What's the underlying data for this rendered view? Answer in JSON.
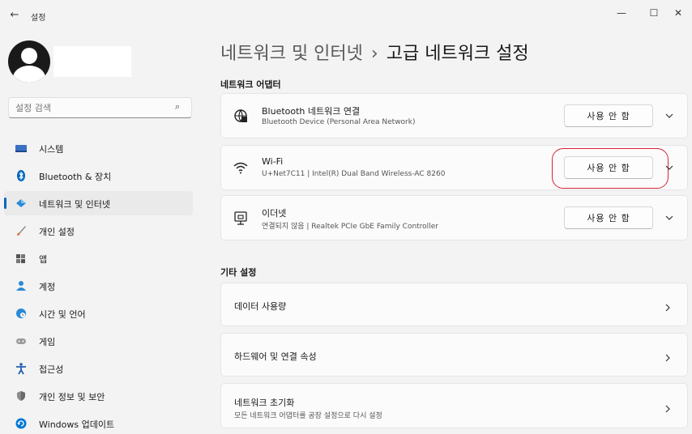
{
  "window": {
    "title": "설정",
    "back_glyph": "←",
    "minimize_glyph": "—",
    "maximize_glyph": "☐",
    "close_glyph": "✕"
  },
  "sidebar": {
    "search": {
      "placeholder": "설정 검색",
      "icon": "⌕"
    },
    "items": [
      {
        "label": "시스템",
        "icon": "monitor-icon",
        "color": "#3a6fc4"
      },
      {
        "label": "Bluetooth & 장치",
        "icon": "bluetooth-icon",
        "color": "#0067c0"
      },
      {
        "label": "네트워크 및 인터넷",
        "icon": "network-diamond-icon",
        "color": "#2a8ad8",
        "selected": true
      },
      {
        "label": "개인 설정",
        "icon": "brush-icon",
        "color": "#d6743a"
      },
      {
        "label": "앱",
        "icon": "apps-icon",
        "color": "#555555"
      },
      {
        "label": "계정",
        "icon": "person-icon",
        "color": "#2a8ad8"
      },
      {
        "label": "시간 및 언어",
        "icon": "globe-clock-icon",
        "color": "#2a8ad8"
      },
      {
        "label": "게임",
        "icon": "gamepad-icon",
        "color": "#888888"
      },
      {
        "label": "접근성",
        "icon": "accessibility-icon",
        "color": "#1f5fb0"
      },
      {
        "label": "개인 정보 및 보안",
        "icon": "shield-icon",
        "color": "#7a7a7a"
      },
      {
        "label": "Windows 업데이트",
        "icon": "update-icon",
        "color": "#0078d4"
      }
    ]
  },
  "main": {
    "breadcrumb": {
      "parent": "네트워크 및 인터넷",
      "separator": "›",
      "current": "고급 네트워크 설정"
    },
    "adapters_section": {
      "title": "네트워크 어댑터",
      "adapters": [
        {
          "name": "Bluetooth 네트워크 연결",
          "description": "Bluetooth Device (Personal Area Network)",
          "button": "사용 안 함",
          "icon": "bluetooth-network-icon"
        },
        {
          "name": "Wi-Fi",
          "description": "U+Net7C11 | Intel(R) Dual Band Wireless-AC 8260",
          "button": "사용 안 함",
          "icon": "wifi-icon",
          "highlighted": true
        },
        {
          "name": "이더넷",
          "description": "연결되지 않음 | Realtek PCIe GbE Family Controller",
          "button": "사용 안 함",
          "icon": "ethernet-icon"
        }
      ]
    },
    "other_section": {
      "title": "기타 설정",
      "items": [
        {
          "label": "데이터 사용량"
        },
        {
          "label": "하드웨어 및 연결 속성"
        },
        {
          "label": "네트워크 초기화",
          "description": "모든 네트워크 어댑터를 공장 설정으로 다시 설정"
        }
      ]
    }
  },
  "colors": {
    "accent": "#0067c0",
    "highlight_ring": "#d9253c",
    "background": "#f3f3f3",
    "card": "#fbfbfb"
  }
}
